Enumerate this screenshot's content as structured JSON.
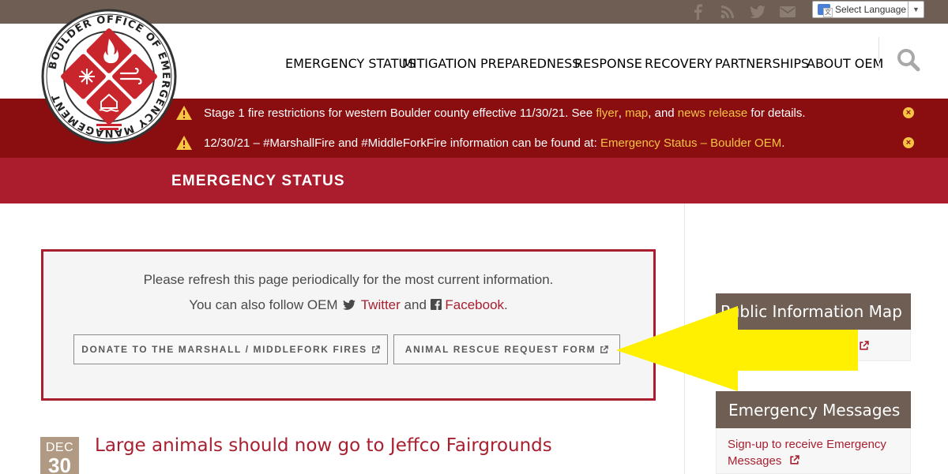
{
  "topbar": {
    "social_icons": [
      "facebook-icon",
      "rss-icon",
      "twitter-icon",
      "email-icon"
    ],
    "language_label": "Select Language"
  },
  "logo": {
    "text": "BOULDER OFFICE OF EMERGENCY MANAGEMENT"
  },
  "nav": {
    "items": [
      "EMERGENCY STATUS",
      "MITIGATION",
      "PREPAREDNESS",
      "RESPONSE",
      "RECOVERY",
      "PARTNERSHIPS",
      "ABOUT OEM"
    ]
  },
  "alerts": [
    {
      "text_before": "Stage 1 fire restrictions for western Boulder county effective 11/30/21. See ",
      "link1": "flyer",
      "sep1": ", ",
      "link2": "map",
      "sep2": ", and ",
      "link3": "news release",
      "text_after": " for details."
    },
    {
      "text_before": "12/30/21 – #MarshallFire and #MiddleForkFire information can be found at: ",
      "link1": "Emergency Status – Boulder OEM",
      "text_after": "."
    }
  ],
  "page_title": "EMERGENCY STATUS",
  "notice": {
    "line1": "Please refresh this page periodically for the most current information.",
    "line2_prefix": "You can also follow OEM",
    "twitter_label": "Twitter",
    "and": "and",
    "facebook_label": "Facebook",
    "period": ".",
    "button1": "DONATE TO THE MARSHALL / MIDDLEFORK FIRES",
    "button2": "ANIMAL RESCUE REQUEST FORM"
  },
  "post": {
    "month": "DEC",
    "day": "30",
    "title": "Large animals should now go to Jeffco Fairgrounds"
  },
  "sidebar": {
    "widget1_title": "Public Information Map",
    "widget2_title": "Emergency Messages",
    "widget2_link": "Sign-up to receive Emergency Messages"
  },
  "colors": {
    "topbar": "#6e5e53",
    "alert_bg": "#8a0d10",
    "title_bg": "#ab1d2c",
    "accent": "#a81f30",
    "link_yellow": "#f6c343",
    "date_bg": "#b09a83",
    "annotation_arrow": "#ffef00"
  }
}
